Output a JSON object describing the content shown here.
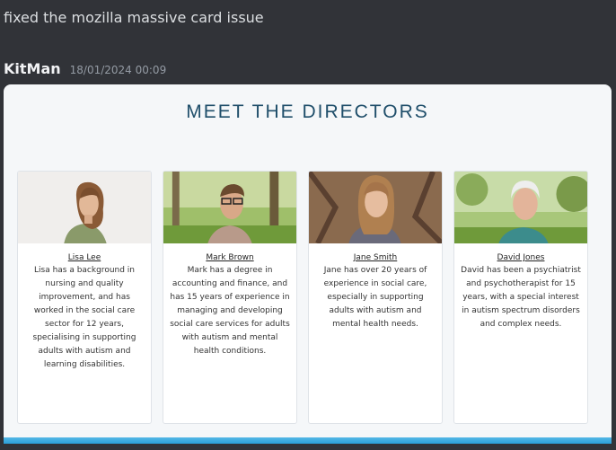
{
  "message": {
    "text": "fixed the mozilla massive card issue",
    "author": "KitMan",
    "timestamp": "18/01/2024 00:09"
  },
  "attachment": {
    "title": "MEET THE DIRECTORS",
    "cards": [
      {
        "name": "Lisa Lee",
        "bio": "Lisa has a background in nursing and quality improvement, and has worked in the social care sector for 12 years, specialising in supporting adults with autism and learning disabilities."
      },
      {
        "name": "Mark Brown",
        "bio": "Mark has a degree in accounting and finance, and has 15 years of experience in managing and developing social care services for adults with autism and mental health conditions."
      },
      {
        "name": "Jane Smith",
        "bio": "Jane has over 20 years of experience in social care, especially in supporting adults with autism and mental health needs."
      },
      {
        "name": "David Jones",
        "bio": "David has been a psychiatrist and psychotherapist for 15 years, with a special interest in autism spectrum disorders and complex needs."
      }
    ]
  },
  "colors": {
    "background": "#313338",
    "title": "#1f4e6a",
    "accent_bar": "#2a9fd8"
  }
}
